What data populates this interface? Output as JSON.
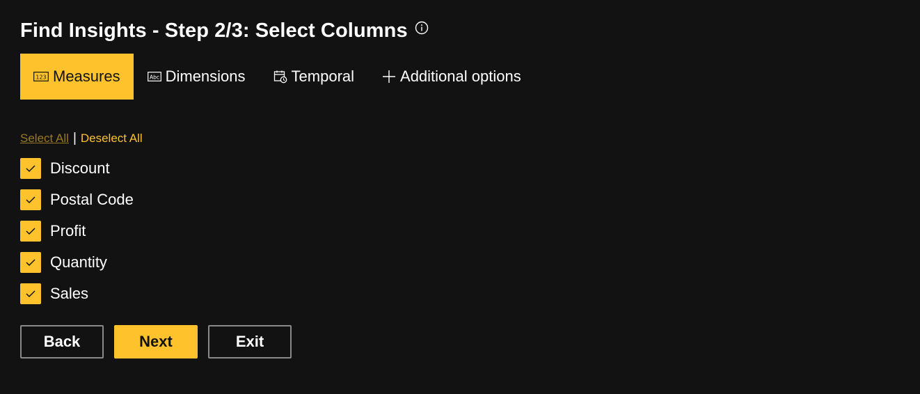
{
  "header": {
    "title": "Find Insights - Step 2/3: Select Columns"
  },
  "tabs": [
    {
      "label": "Measures",
      "icon": "numeric-123-icon",
      "active": true
    },
    {
      "label": "Dimensions",
      "icon": "text-abc-icon",
      "active": false
    },
    {
      "label": "Temporal",
      "icon": "calendar-clock-icon",
      "active": false
    },
    {
      "label": "Additional options",
      "icon": "plus-icon",
      "active": false
    }
  ],
  "selection": {
    "select_all": "Select All",
    "separator": "|",
    "deselect_all": "Deselect All"
  },
  "columns": [
    {
      "label": "Discount",
      "checked": true
    },
    {
      "label": "Postal Code",
      "checked": true
    },
    {
      "label": "Profit",
      "checked": true
    },
    {
      "label": "Quantity",
      "checked": true
    },
    {
      "label": "Sales",
      "checked": true
    }
  ],
  "buttons": {
    "back": "Back",
    "next": "Next",
    "exit": "Exit"
  },
  "colors": {
    "background": "#121212",
    "accent": "#fec22d",
    "select_all_link": "#9a7a22"
  }
}
